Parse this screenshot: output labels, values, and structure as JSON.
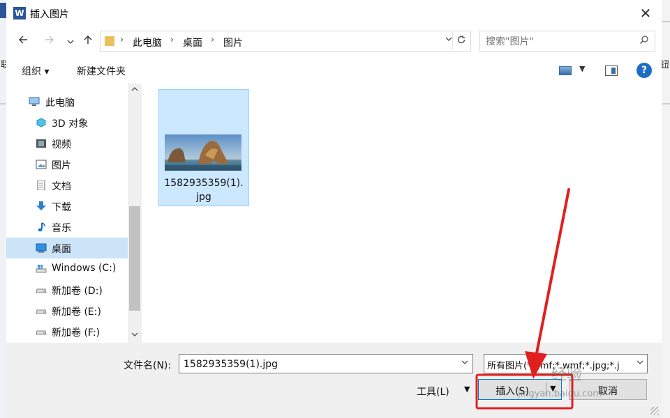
{
  "window": {
    "app_icon": "word-icon",
    "app_icon_letter": "W",
    "title": "插入图片",
    "close_icon": "✕"
  },
  "background_edges": {
    "left_text": "联",
    "right_text": "钮"
  },
  "navigation": {
    "back_icon": "arrow-left-icon",
    "forward_icon": "arrow-right-icon",
    "recent_icon": "chevron-down-icon",
    "up_icon": "arrow-up-icon",
    "breadcrumbs": [
      "此电脑",
      "桌面",
      "图片"
    ],
    "refresh_icon": "refresh-icon"
  },
  "search": {
    "placeholder": "搜索\"图片\""
  },
  "commandbar": {
    "organize": "组织 ▾",
    "new_folder": "新建文件夹",
    "help": "?"
  },
  "nav_tree": [
    {
      "label": "此电脑",
      "icon": "computer-icon"
    },
    {
      "label": "3D 对象",
      "icon": "cube-icon"
    },
    {
      "label": "视频",
      "icon": "video-icon"
    },
    {
      "label": "图片",
      "icon": "picture-icon"
    },
    {
      "label": "文档",
      "icon": "document-icon"
    },
    {
      "label": "下载",
      "icon": "download-icon"
    },
    {
      "label": "音乐",
      "icon": "music-icon"
    },
    {
      "label": "桌面",
      "icon": "desktop-icon",
      "selected": true
    },
    {
      "label": "Windows (C:)",
      "icon": "windows-drive-icon"
    },
    {
      "label": "新加卷 (D:)",
      "icon": "drive-icon"
    },
    {
      "label": "新加卷 (E:)",
      "icon": "drive-icon"
    },
    {
      "label": "新加卷 (F:)",
      "icon": "drive-icon"
    }
  ],
  "files": [
    {
      "name_line1": "1582935359(1).",
      "name_line2": "jpg",
      "icon": "image-thumbnail"
    }
  ],
  "footer": {
    "filename_label": "文件名(N):",
    "filename_value": "1582935359(1).jpg",
    "filetype_value": "所有图片(*.emf;*.wmf;*.jpg;*.j",
    "tools_label": "工具(L)",
    "insert_label": "插入(S)",
    "cancel_label": "取消"
  },
  "watermark": {
    "text": "经验",
    "sub": "jingyan.baidu.com"
  },
  "colors": {
    "selection": "#cce4f7",
    "tile_selection": "#cce8ff",
    "annotation": "#e0201f",
    "primary_border": "#0078d7"
  }
}
